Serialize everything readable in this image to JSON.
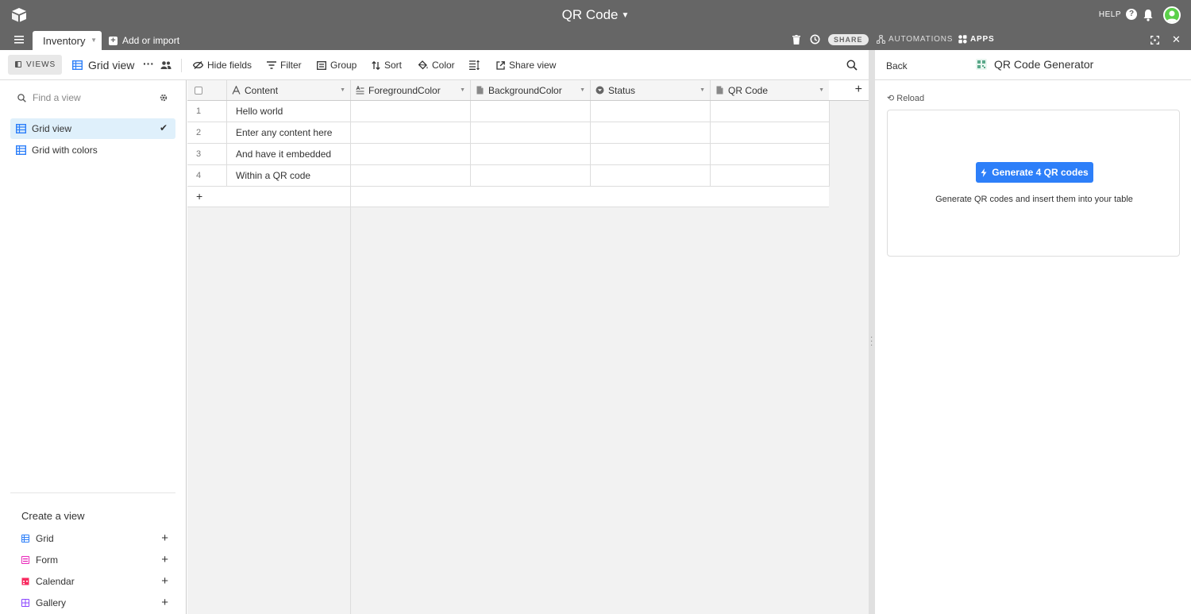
{
  "header": {
    "base_title": "QR Code",
    "help_label": "HELP",
    "share_label": "SHARE",
    "automations_label": "AUTOMATIONS",
    "apps_label": "APPS",
    "table_tab": "Inventory",
    "add_import": "Add or import"
  },
  "toolbar": {
    "views_label": "VIEWS",
    "current_view": "Grid view",
    "hide_fields": "Hide fields",
    "filter": "Filter",
    "group": "Group",
    "sort": "Sort",
    "color": "Color",
    "share_view": "Share view"
  },
  "sidebar": {
    "search_placeholder": "Find a view",
    "views": [
      {
        "label": "Grid view",
        "active": true
      },
      {
        "label": "Grid with colors",
        "active": false
      }
    ],
    "create_title": "Create a view",
    "create_items": [
      {
        "label": "Grid",
        "color": "#2d7ff9"
      },
      {
        "label": "Form",
        "color": "#e929ba"
      },
      {
        "label": "Calendar",
        "color": "#f82b60"
      },
      {
        "label": "Gallery",
        "color": "#8b46ff"
      }
    ]
  },
  "grid": {
    "columns": [
      {
        "label": "Content",
        "icon": "text-icon"
      },
      {
        "label": "ForegroundColor",
        "icon": "long-text-icon"
      },
      {
        "label": "BackgroundColor",
        "icon": "attachment-icon"
      },
      {
        "label": "Status",
        "icon": "single-select-icon"
      },
      {
        "label": "QR Code",
        "icon": "attachment-icon"
      }
    ],
    "rows": [
      {
        "num": "1",
        "content": "Hello world"
      },
      {
        "num": "2",
        "content": "Enter any content here"
      },
      {
        "num": "3",
        "content": "And have it embedded"
      },
      {
        "num": "4",
        "content": "Within a QR code"
      }
    ]
  },
  "panel": {
    "back_label": "Back",
    "app_title": "QR Code Generator",
    "reload_label": "Reload",
    "generate_button": "Generate 4 QR codes",
    "description": "Generate QR codes and insert them into your table"
  },
  "colors": {
    "topbar": "#666666",
    "accent": "#2d7ff9",
    "active_view_bg": "#dff0fb"
  }
}
